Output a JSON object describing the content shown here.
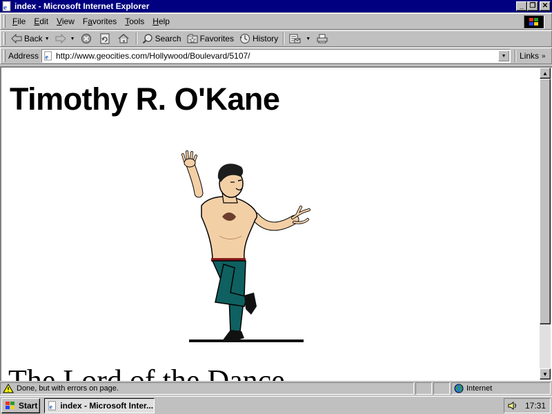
{
  "window": {
    "title": "index - Microsoft Internet Explorer",
    "buttons": {
      "minimize": "_",
      "maximize": "❐",
      "close": "✕"
    }
  },
  "menu": {
    "items": [
      {
        "label": "File",
        "u": "F",
        "rest": "ile"
      },
      {
        "label": "Edit",
        "u": "E",
        "rest": "dit"
      },
      {
        "label": "View",
        "u": "V",
        "rest": "iew"
      },
      {
        "label": "Favorites",
        "u": "a",
        "pre": "F",
        "rest": "vorites"
      },
      {
        "label": "Tools",
        "u": "T",
        "rest": "ools"
      },
      {
        "label": "Help",
        "u": "H",
        "rest": "elp"
      }
    ]
  },
  "toolbar": {
    "back": "Back",
    "search": "Search",
    "favorites": "Favorites",
    "history": "History"
  },
  "address": {
    "label": "Address",
    "url": "http://www.geocities.com/Hollywood/Boulevard/5107/",
    "links": "Links"
  },
  "page": {
    "heading": "Timothy R. O'Kane",
    "subheading": "The Lord of the Dance"
  },
  "status": {
    "message": "Done, but with errors on page.",
    "zone": "Internet"
  },
  "taskbar": {
    "start": "Start",
    "task": "index - Microsoft Inter...",
    "clock": "17:31"
  },
  "colors": {
    "titlebar": "#000080",
    "chrome": "#c0c0c0",
    "page_bg": "#ffffff"
  },
  "icons": [
    "ie-page-icon",
    "back-arrow-icon",
    "forward-arrow-icon",
    "stop-icon",
    "refresh-icon",
    "home-icon",
    "search-icon",
    "favorites-icon",
    "history-icon",
    "mail-icon",
    "print-icon",
    "warning-icon",
    "globe-icon",
    "speaker-icon",
    "windows-logo-icon"
  ]
}
